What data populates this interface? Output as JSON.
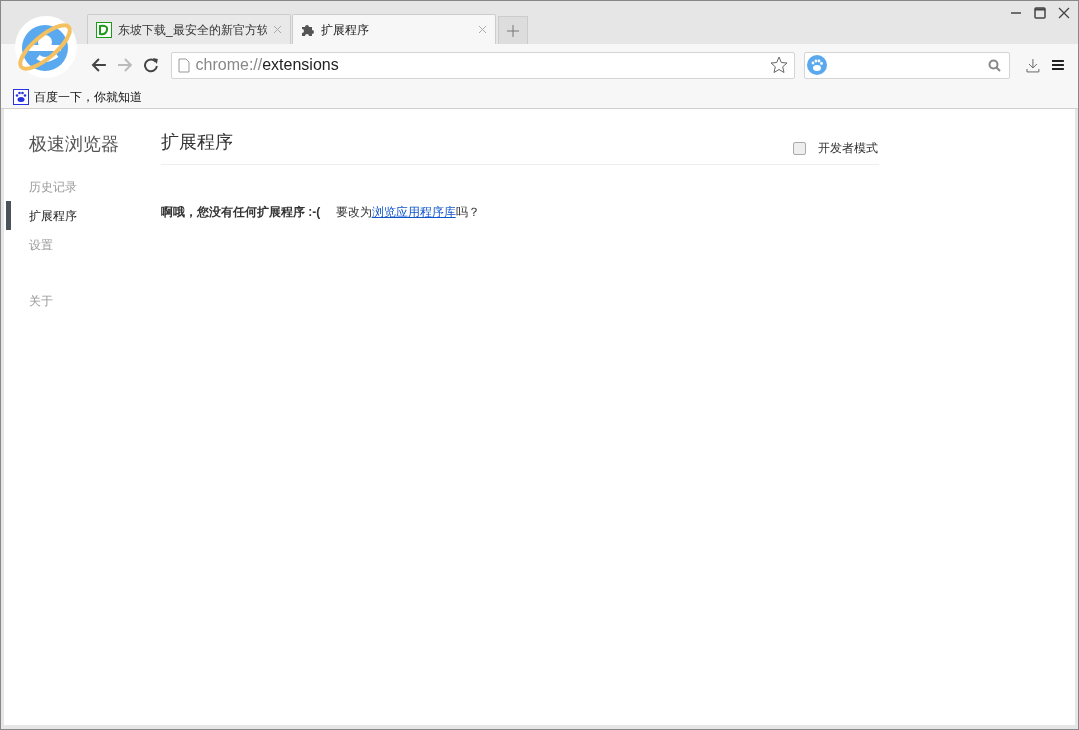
{
  "tabs": [
    {
      "title": "东坡下载_最安全的新官方软",
      "kind": "site",
      "selected": false
    },
    {
      "title": "扩展程序",
      "kind": "puzzle",
      "selected": true
    }
  ],
  "address": {
    "scheme": "chrome://",
    "path": "extensions"
  },
  "bookmarks": [
    {
      "title": "百度一下，你就知道"
    }
  ],
  "sidebar": {
    "title": "极速浏览器",
    "sections": [
      [
        {
          "label": "历史记录",
          "selected": false
        },
        {
          "label": "扩展程序",
          "selected": true
        },
        {
          "label": "设置",
          "selected": false
        }
      ],
      [
        {
          "label": "关于",
          "selected": false
        }
      ]
    ]
  },
  "page": {
    "title": "扩展程序",
    "developer_mode": {
      "label": "开发者模式",
      "checked": false
    },
    "message": {
      "text": "**啊哦，您没有任何扩展程序 :-(**　 要改为",
      "link": "浏览应用程序库",
      "after": "吗？"
    }
  }
}
